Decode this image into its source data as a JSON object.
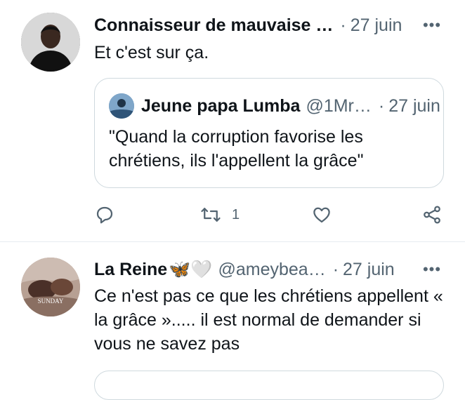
{
  "tweets": [
    {
      "author": "Connaisseur de mauvaise …",
      "separator": "·",
      "date": "27 juin",
      "text": "Et c'est sur ça.",
      "quote": {
        "author": "Jeune papa Lumba",
        "handle": "@1Mr…",
        "separator": "·",
        "date": "27 juin",
        "text": "\"Quand la corruption favorise les chrétiens, ils l'appellent la grâce\""
      },
      "actions": {
        "retweet_count": "1"
      }
    },
    {
      "author": "La Reine",
      "author_emoji": "🦋🤍",
      "handle": "@ameybea…",
      "separator": "·",
      "date": "27 juin",
      "text": "Ce n'est pas ce que les chrétiens appellent « la grâce »..... il est normal de demander si vous ne savez pas",
      "avatar_text": "SUNDAY"
    }
  ],
  "icons": [
    "more-icon",
    "reply-icon",
    "retweet-icon",
    "like-icon",
    "share-icon"
  ],
  "colors": {
    "text": "#0f1419",
    "secondary": "#536471",
    "border": "#cfd9de"
  }
}
